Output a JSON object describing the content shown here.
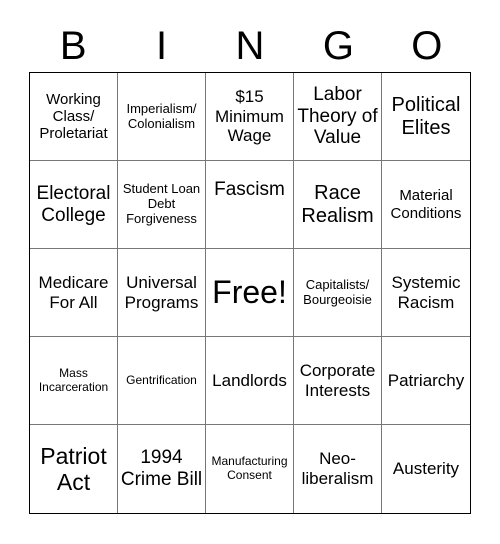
{
  "header": [
    "B",
    "I",
    "N",
    "G",
    "O"
  ],
  "cells": [
    "Working Class/ Proletariat",
    "Imperialism/ Colonialism",
    "$15 Minimum Wage",
    "Labor Theory of Value",
    "Political Elites",
    "Electoral College",
    "Student Loan Debt Forgiveness",
    "Fascism",
    "Race Realism",
    "Material Conditions",
    "Medicare For All",
    "Universal Programs",
    "Free!",
    "Capitalists/ Bourgeoisie",
    "Systemic Racism",
    "Mass Incarceration",
    "Gentrification",
    "Landlords",
    "Corporate Interests",
    "Patriarchy",
    "Patriot Act",
    "1994 Crime Bill",
    "Manufacturing Consent",
    "Neo-liberalism",
    "Austerity"
  ]
}
